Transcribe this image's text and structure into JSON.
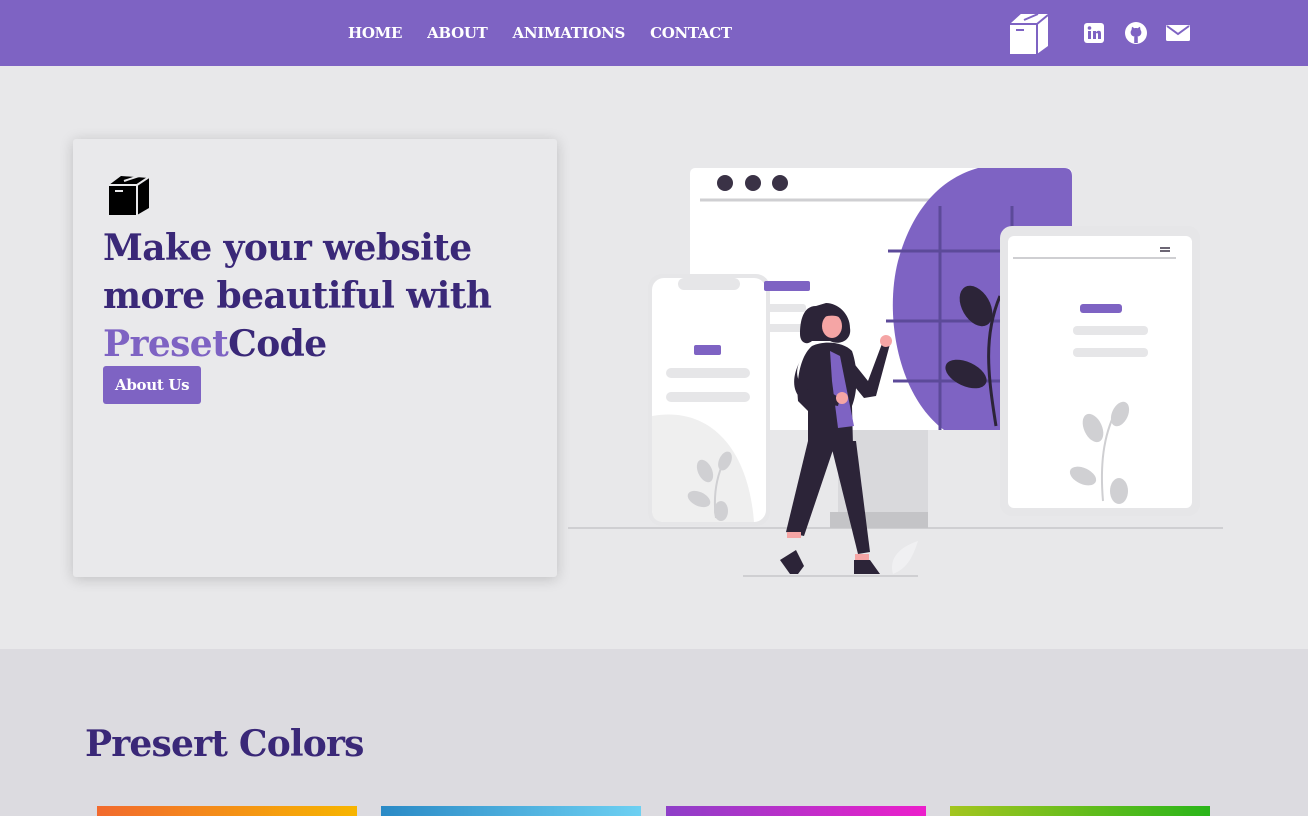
{
  "nav": {
    "links": [
      "HOME",
      "ABOUT",
      "ANIMATIONS",
      "CONTACT"
    ],
    "social_icons": [
      "linkedin-icon",
      "github-icon",
      "mail-icon"
    ],
    "logo_icon": "box-icon"
  },
  "hero": {
    "title_line1": "Make your website",
    "title_line2": "more beautiful with",
    "brand_part1": "Preset",
    "brand_part2": "Code",
    "button_label": "About Us",
    "icon": "box-icon"
  },
  "colors_section": {
    "title": "Presert Colors",
    "gradients": [
      [
        "#f26a2e",
        "#f7b500"
      ],
      [
        "#2a8ac6",
        "#6dd0f2"
      ],
      [
        "#8e3fc8",
        "#ec1fcb"
      ],
      [
        "#a3c51f",
        "#2ab51a"
      ]
    ]
  },
  "colors": {
    "accent": "#7e63c3",
    "heading": "#3a2878",
    "background": "#e8e8ea",
    "section_background": "#dcdbe0"
  }
}
